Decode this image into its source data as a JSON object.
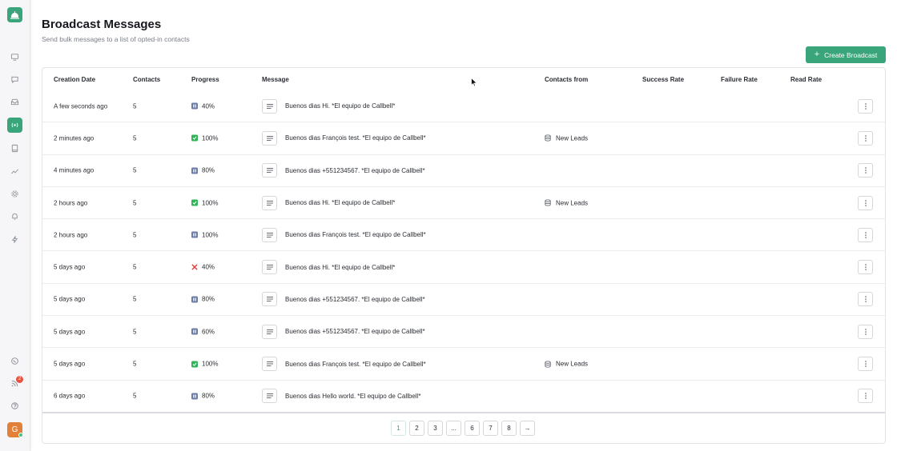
{
  "header": {
    "title": "Broadcast Messages",
    "subtitle": "Send bulk messages to a list of opted-in contacts",
    "create_label": "Create Broadcast"
  },
  "colors": {
    "accent": "#3aa57a",
    "paused": "#6c7da5",
    "done": "#2fb457",
    "failed": "#d93a33"
  },
  "sidebar": {
    "icons": [
      "monitor-icon",
      "chat-icon",
      "inbox-icon",
      "broadcast-icon",
      "book-icon",
      "trend-icon",
      "gear-icon",
      "bell-icon",
      "bolt-icon",
      "whatsapp-icon",
      "rss-icon",
      "help-icon"
    ],
    "active": "broadcast-icon",
    "notification_count": "2",
    "avatar_initial": "G"
  },
  "table": {
    "columns": [
      "Creation Date",
      "Contacts",
      "Progress",
      "Message",
      "Contacts from",
      "Success Rate",
      "Failure Rate",
      "Read Rate"
    ],
    "rows": [
      {
        "date": "A few seconds ago",
        "contacts": "5",
        "status": "paused",
        "progress": "40%",
        "message": "Buenos dias Hi. *El equipo de Callbell*",
        "from": ""
      },
      {
        "date": "2 minutes ago",
        "contacts": "5",
        "status": "done",
        "progress": "100%",
        "message": "Buenos dias François test. *El equipo de Callbell*",
        "from": "New Leads"
      },
      {
        "date": "4 minutes ago",
        "contacts": "5",
        "status": "paused",
        "progress": "80%",
        "message": "Buenos dias +551234567. *El equipo de Callbell*",
        "from": ""
      },
      {
        "date": "2 hours ago",
        "contacts": "5",
        "status": "done",
        "progress": "100%",
        "message": "Buenos dias Hi. *El equipo de Callbell*",
        "from": "New Leads"
      },
      {
        "date": "2 hours ago",
        "contacts": "5",
        "status": "paused",
        "progress": "100%",
        "message": "Buenos dias François test. *El equipo de Callbell*",
        "from": ""
      },
      {
        "date": "5 days ago",
        "contacts": "5",
        "status": "failed",
        "progress": "40%",
        "message": "Buenos dias Hi. *El equipo de Callbell*",
        "from": ""
      },
      {
        "date": "5 days ago",
        "contacts": "5",
        "status": "paused",
        "progress": "80%",
        "message": "Buenos dias +551234567. *El equipo de Callbell*",
        "from": ""
      },
      {
        "date": "5 days ago",
        "contacts": "5",
        "status": "paused",
        "progress": "60%",
        "message": "Buenos dias +551234567. *El equipo de Callbell*",
        "from": ""
      },
      {
        "date": "5 days ago",
        "contacts": "5",
        "status": "done",
        "progress": "100%",
        "message": "Buenos dias François test. *El equipo de Callbell*",
        "from": "New Leads"
      },
      {
        "date": "6 days ago",
        "contacts": "5",
        "status": "paused",
        "progress": "80%",
        "message": "Buenos dias Hello world. *El equipo de Callbell*",
        "from": ""
      }
    ]
  },
  "pagination": {
    "pages": [
      "1",
      "2",
      "3",
      "...",
      "6",
      "7",
      "8"
    ],
    "current": "1",
    "next_label": "→"
  }
}
